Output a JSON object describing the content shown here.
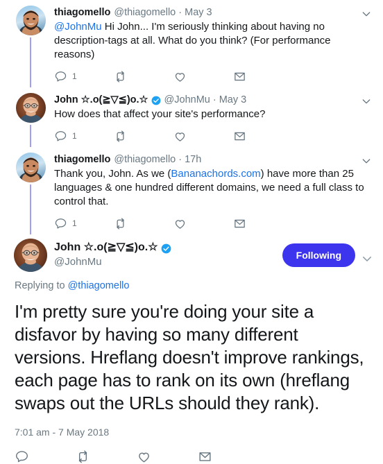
{
  "thread": {
    "replies": [
      {
        "display_name": "thiagomello",
        "handle": "@thiagomello",
        "separator": "·",
        "timestamp": "May 3",
        "verified": false,
        "avatar": "thiagomello-avatar",
        "text_segments": [
          {
            "type": "mention",
            "text": "@JohnMu"
          },
          {
            "type": "plain",
            "text": " Hi John... I'm seriously thinking about having no description-tags at all. What do you think? (For performance reasons)"
          }
        ],
        "actions": {
          "reply_count": "1",
          "retweet_count": "",
          "like_count": "",
          "dm_count": ""
        }
      },
      {
        "display_name": "John ☆.o(≧▽≦)o.☆",
        "handle": "@JohnMu",
        "separator": "·",
        "timestamp": "May 3",
        "verified": true,
        "avatar": "johnmu-avatar",
        "text_segments": [
          {
            "type": "plain",
            "text": "How does that affect your site's performance?"
          }
        ],
        "actions": {
          "reply_count": "1",
          "retweet_count": "",
          "like_count": "",
          "dm_count": ""
        }
      },
      {
        "display_name": "thiagomello",
        "handle": "@thiagomello",
        "separator": "·",
        "timestamp": "17h",
        "verified": false,
        "avatar": "thiagomello-avatar",
        "text_segments": [
          {
            "type": "plain",
            "text": "Thank you, John. As we ("
          },
          {
            "type": "link",
            "text": "Bananachords.com"
          },
          {
            "type": "plain",
            "text": ") have more than 25 languages & one hundred different domains, we need a full class to control that."
          }
        ],
        "actions": {
          "reply_count": "1",
          "retweet_count": "",
          "like_count": "",
          "dm_count": ""
        }
      }
    ],
    "main_tweet": {
      "display_name": "John ☆.o(≧▽≦)o.☆",
      "handle": "@JohnMu",
      "verified": true,
      "avatar": "johnmu-avatar",
      "follow_button_label": "Following",
      "replying_to_prefix": "Replying to",
      "replying_to_handle": "@thiagomello",
      "text": "I'm pretty sure you're doing your site a disfavor by having so many different versions. Hreflang doesn't improve rankings, each page has to rank on its own (hreflang swaps out the URLs should they rank).",
      "timestamp": "7:01 am - 7 May 2018",
      "actions": {
        "reply_count": "",
        "retweet_count": "",
        "like_count": "",
        "dm_count": ""
      }
    }
  },
  "icons": {
    "reply": "reply-icon",
    "retweet": "retweet-icon",
    "like": "heart-icon",
    "dm": "envelope-icon",
    "caret": "chevron-down-icon",
    "verified": "verified-badge-icon"
  },
  "colors": {
    "link": "#1b72e8",
    "muted_text": "#697882",
    "icon": "#66757f",
    "follow_button_bg": "#3d35ee",
    "thread_line": "#9f9ff5",
    "verified_badge": "#1da1f2",
    "text": "#14171a"
  }
}
